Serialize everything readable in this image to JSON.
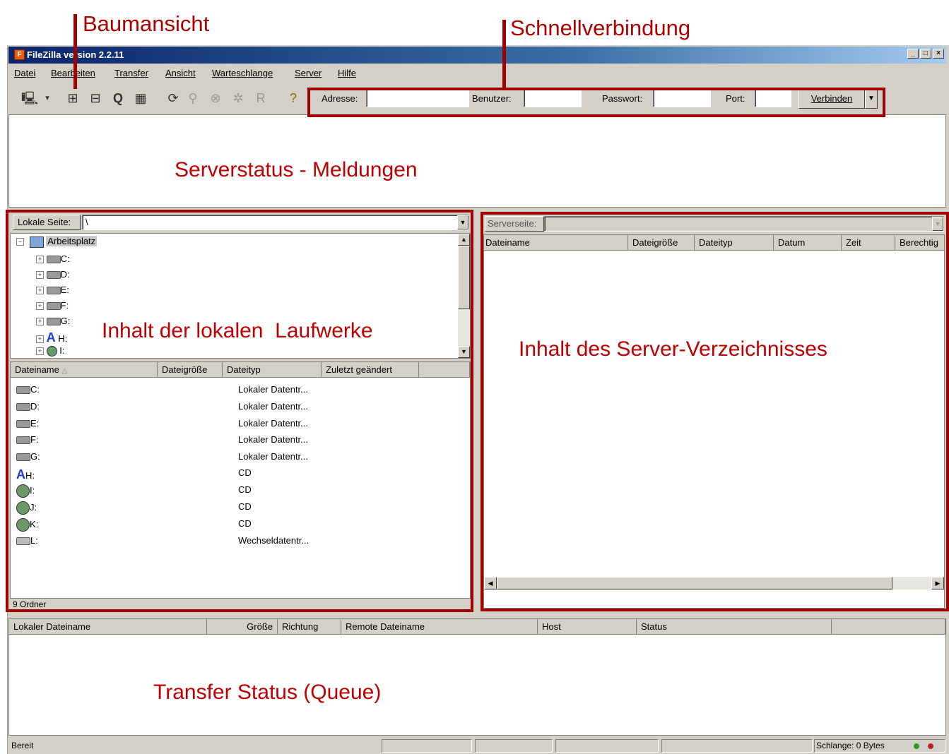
{
  "annotations": {
    "tree_view": "Baumansicht",
    "quick_connect": "Schnellverbindung",
    "server_status": "Serverstatus - Meldungen",
    "local_drives": "Inhalt der lokalen  Laufwerke",
    "server_dir": "Inhalt des Server-Verzeichnisses",
    "transfer_status": "Transfer Status (Queue)"
  },
  "window": {
    "title": "FileZilla version 2.2.11",
    "minimize": "_",
    "maximize": "□",
    "close": "×"
  },
  "menu": [
    "Datei",
    "Bearbeiten",
    "Transfer",
    "Ansicht",
    "Warteschlange",
    "Server",
    "Hilfe"
  ],
  "quickconnect": {
    "address_label": "Adresse:",
    "address_value": "",
    "user_label": "Benutzer:",
    "user_value": "",
    "password_label": "Passwort:",
    "password_value": "",
    "port_label": "Port:",
    "port_value": "",
    "connect_label": "Verbinden"
  },
  "local": {
    "path_label": "Lokale Seite:",
    "path_value": "\\",
    "tree_root": "Arbeitsplatz",
    "tree_items": [
      "C:",
      "D:",
      "E:",
      "F:",
      "G:",
      "H:",
      "I:"
    ],
    "columns": [
      "Dateiname",
      "Dateigröße",
      "Dateityp",
      "Zuletzt geändert"
    ],
    "rows": [
      {
        "name": "C:",
        "type": "Lokaler Datentr...",
        "icon": "hard-drive-icon"
      },
      {
        "name": "D:",
        "type": "Lokaler Datentr...",
        "icon": "hard-drive-icon"
      },
      {
        "name": "E:",
        "type": "Lokaler Datentr...",
        "icon": "hard-drive-icon"
      },
      {
        "name": "F:",
        "type": "Lokaler Datentr...",
        "icon": "hard-drive-icon"
      },
      {
        "name": "G:",
        "type": "Lokaler Datentr...",
        "icon": "hard-drive-icon"
      },
      {
        "name": "H:",
        "type": "CD",
        "icon": "cd-a-icon"
      },
      {
        "name": "I:",
        "type": "CD",
        "icon": "cd-drive-icon"
      },
      {
        "name": "J:",
        "type": "CD",
        "icon": "cd-drive-icon"
      },
      {
        "name": "K:",
        "type": "CD",
        "icon": "cd-drive-icon"
      },
      {
        "name": "L:",
        "type": "Wechseldatentr...",
        "icon": "removable-drive-icon"
      }
    ],
    "status": "9 Ordner"
  },
  "remote": {
    "path_label": "Serverseite:",
    "columns": [
      "Dateiname",
      "Dateigröße",
      "Dateityp",
      "Datum",
      "Zeit",
      "Berechtig"
    ]
  },
  "queue": {
    "columns": [
      "Lokaler Dateiname",
      "Größe",
      "Richtung",
      "Remote Dateiname",
      "Host",
      "Status"
    ]
  },
  "statusbar": {
    "left": "Bereit",
    "queue": "Schlange: 0 Bytes"
  },
  "colors": {
    "annotation": "#c00000",
    "frame": "#a00000",
    "titlebar": "#0a246a"
  }
}
